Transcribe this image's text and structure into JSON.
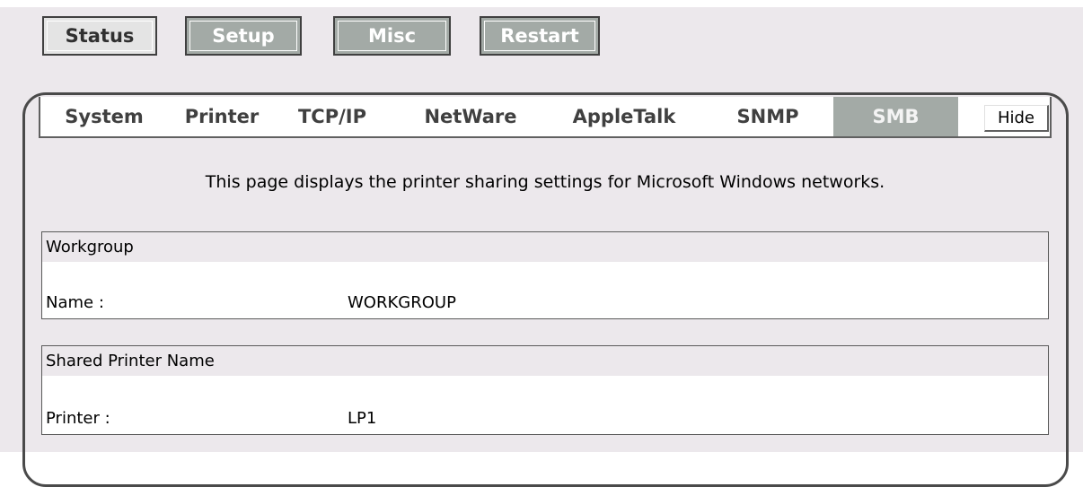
{
  "top_nav": {
    "status": "Status",
    "setup": "Setup",
    "misc": "Misc",
    "restart": "Restart"
  },
  "tabs": [
    {
      "label": "System"
    },
    {
      "label": "Printer"
    },
    {
      "label": "TCP/IP"
    },
    {
      "label": "NetWare"
    },
    {
      "label": "AppleTalk"
    },
    {
      "label": "SNMP"
    },
    {
      "label": "SMB",
      "active": true
    }
  ],
  "hide_label": "Hide",
  "description": "This page displays the printer sharing settings for Microsoft Windows networks.",
  "workgroup": {
    "header": "Workgroup",
    "name_label": "Name :",
    "name_value": "WORKGROUP"
  },
  "shared_printer": {
    "header": "Shared Printer Name",
    "printer_label": "Printer :",
    "printer_value": "LP1"
  },
  "colors": {
    "background": "#ece8ec",
    "button_grey": "#a3aaa6",
    "frame_border": "#4a4a4a"
  }
}
